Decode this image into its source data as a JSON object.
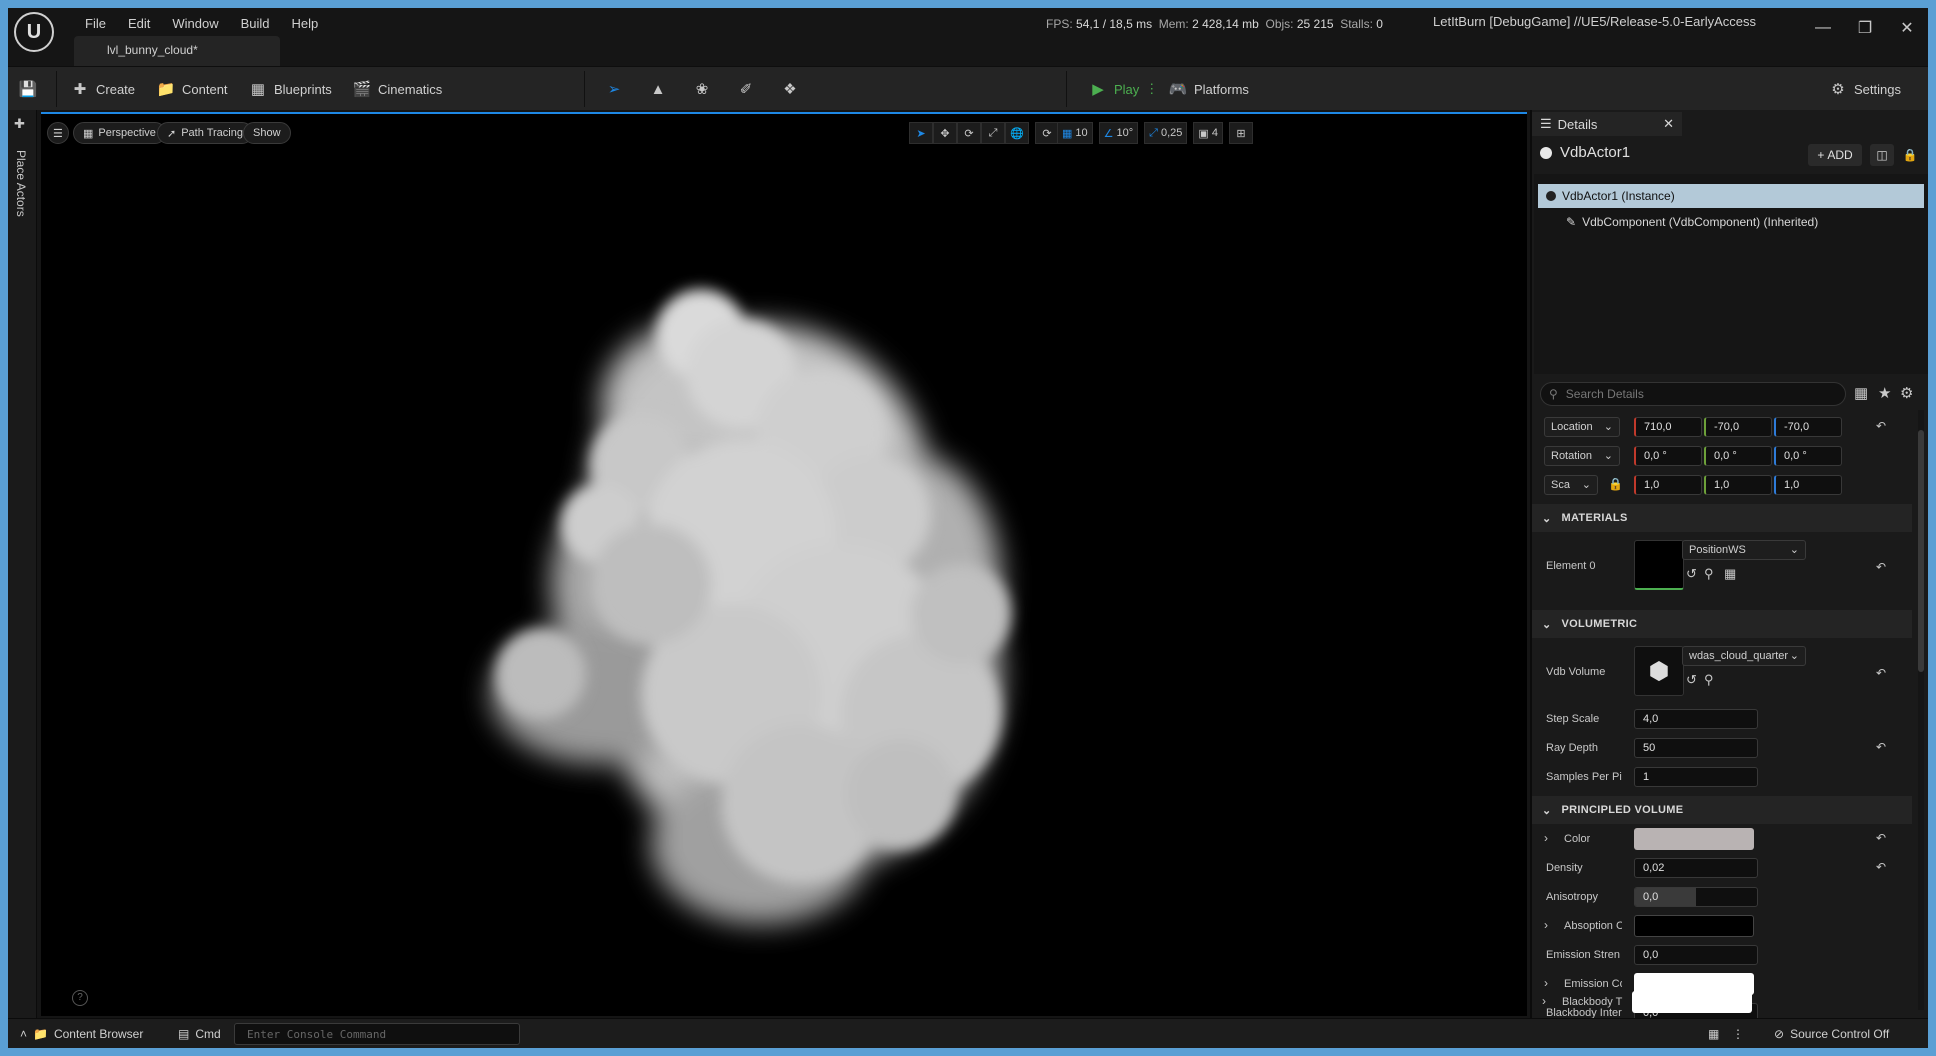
{
  "titlebar": {
    "logo": "U",
    "menu": [
      "File",
      "Edit",
      "Window",
      "Build",
      "Help"
    ],
    "doc_tab": "lvl_bunny_cloud*",
    "stats": {
      "fps_label": "FPS:",
      "fps_value": "54,1",
      "ms_value": "/ 18,5 ms",
      "mem_label": "Mem:",
      "mem_value": "2 428,14 mb",
      "objs_label": "Objs:",
      "objs_value": "25 215",
      "stalls_label": "Stalls:",
      "stalls_value": "0"
    },
    "project_title": "LetItBurn [DebugGame] //UE5/Release-5.0-EarlyAccess"
  },
  "toolbar": {
    "create": "Create",
    "content": "Content",
    "blueprints": "Blueprints",
    "cinematics": "Cinematics",
    "play": "Play",
    "platforms": "Platforms",
    "settings": "Settings"
  },
  "leftstrip": {
    "place_actors": "Place Actors"
  },
  "viewport": {
    "perspective": "Perspective",
    "path_tracing": "Path Tracing",
    "show": "Show",
    "grid_snap": "10",
    "rot_snap": "10°",
    "scale_snap": "0,25",
    "cam_speed": "4"
  },
  "details": {
    "tab_label": "Details",
    "actor_name": "VdbActor1",
    "add_label": "ADD",
    "tree": [
      "VdbActor1  (Instance)",
      "VdbComponent (VdbComponent) (Inherited)"
    ],
    "search_placeholder": "Search Details",
    "transform": {
      "location_label": "Location",
      "location": [
        "710,0",
        "-70,0",
        "-70,0"
      ],
      "rotation_label": "Rotation",
      "rotation": [
        "0,0 °",
        "0,0 °",
        "0,0 °"
      ],
      "scale_label": "Sca",
      "scale": [
        "1,0",
        "1,0",
        "1,0"
      ]
    },
    "materials": {
      "header": "MATERIALS",
      "element_label": "Element 0",
      "material": "PositionWS"
    },
    "volumetric": {
      "header": "VOLUMETRIC",
      "vdb_label": "Vdb Volume",
      "vdb_asset": "wdas_cloud_quarter",
      "step_scale_label": "Step Scale",
      "step_scale": "4,0",
      "ray_depth_label": "Ray Depth",
      "ray_depth": "50",
      "samples_label": "Samples Per Pi",
      "samples": "1"
    },
    "principled": {
      "header": "PRINCIPLED VOLUME",
      "color_label": "Color",
      "color_hex": "#b9b3b3",
      "density_label": "Density",
      "density": "0,02",
      "anisotropy_label": "Anisotropy",
      "anisotropy": "0,0",
      "anisotropy_level": 0.5,
      "absorption_label": "Absoption Cc",
      "absorption_hex": "#000000",
      "emission_strength_label": "Emission Stren",
      "emission_strength": "0,0",
      "emission_color_label": "Emission Co",
      "emission_color_hex": "#ffffff",
      "blackbody_intensity_label": "Blackbody Inter",
      "blackbody_intensity": "0,0",
      "blackbody_tint_label": "Blackbody T",
      "blackbody_tint_hex": "#ffffff"
    }
  },
  "statusbar": {
    "content_browser": "Content Browser",
    "cmd": "Cmd",
    "console_placeholder": "Enter Console Command",
    "source_control": "Source Control Off"
  },
  "colors": {
    "accent_blue": "#1e88e5",
    "play_green": "#4caf50",
    "selection": "#b3c9d8"
  }
}
